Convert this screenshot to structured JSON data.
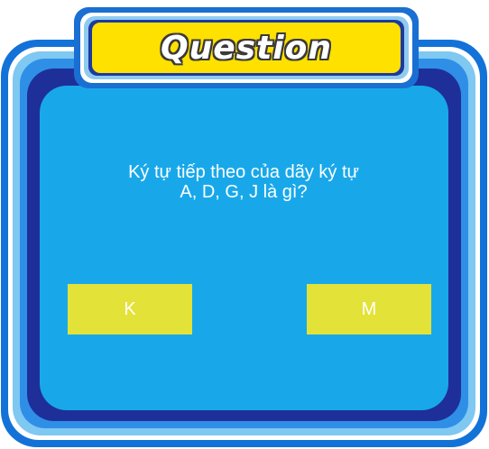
{
  "title": "Question",
  "question": {
    "line1": "Ký tự tiếp theo của dãy ký tự",
    "line2": "A, D, G, J là gì?"
  },
  "answers": [
    {
      "label": "K"
    },
    {
      "label": "M"
    }
  ],
  "colors": {
    "panel": "#18a8ea",
    "frame_outer": "#1272d8",
    "frame_navy": "#1e2f9a",
    "banner": "#ffe100",
    "answer_button": "#e3e238",
    "text": "#ffffff"
  }
}
